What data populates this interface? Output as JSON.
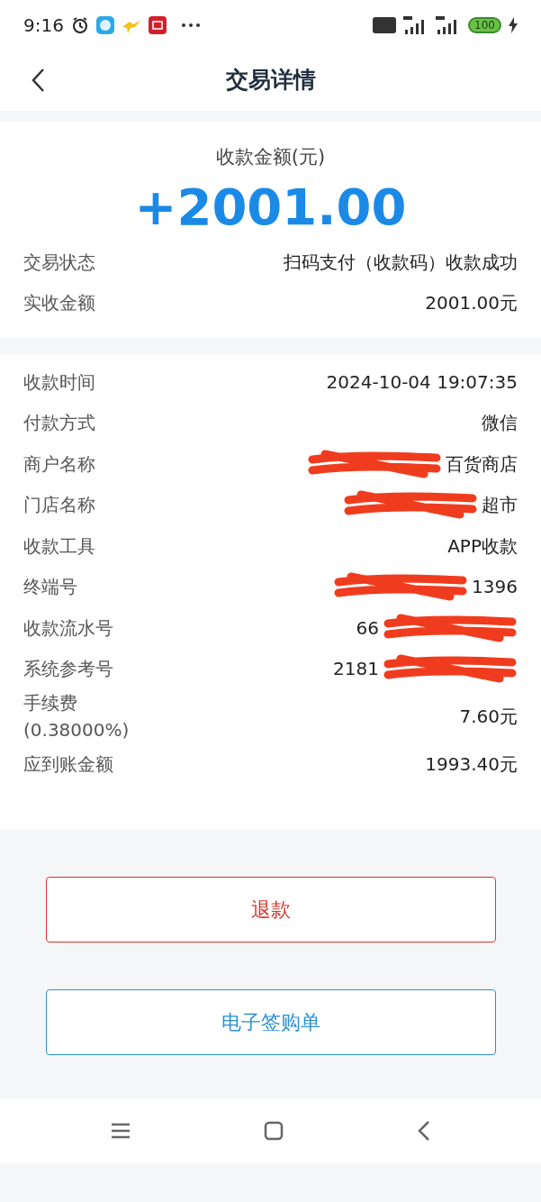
{
  "status_bar": {
    "time": "9:16",
    "battery": "100"
  },
  "header": {
    "title": "交易详情"
  },
  "amount": {
    "label": "收款金额(元)",
    "value": "+2001.00"
  },
  "summary": [
    {
      "label": "交易状态",
      "value": "扫码支付（收款码）收款成功"
    },
    {
      "label": "实收金额",
      "value": "2001.00元"
    }
  ],
  "details": [
    {
      "label": "收款时间",
      "value": "2024-10-04 19:07:35"
    },
    {
      "label": "付款方式",
      "value": "微信"
    },
    {
      "label": "商户名称",
      "value": "百货商店",
      "scribble_before": true
    },
    {
      "label": "门店名称",
      "value": "超市",
      "scribble_before": true
    },
    {
      "label": "收款工具",
      "value": "APP收款"
    },
    {
      "label": "终端号",
      "value": "1396",
      "scribble_before": true
    },
    {
      "label": "收款流水号",
      "value": "66",
      "scribble_after": true
    },
    {
      "label": "系统参考号",
      "value": "2181",
      "scribble_after": true
    },
    {
      "label": "手续费",
      "sublabel": "(0.38000%)",
      "value": "7.60元"
    },
    {
      "label": "应到账金额",
      "value": "1993.40元"
    }
  ],
  "buttons": [
    {
      "label": "退款",
      "kind": "danger"
    },
    {
      "label": "电子签购单",
      "kind": "primary"
    }
  ]
}
